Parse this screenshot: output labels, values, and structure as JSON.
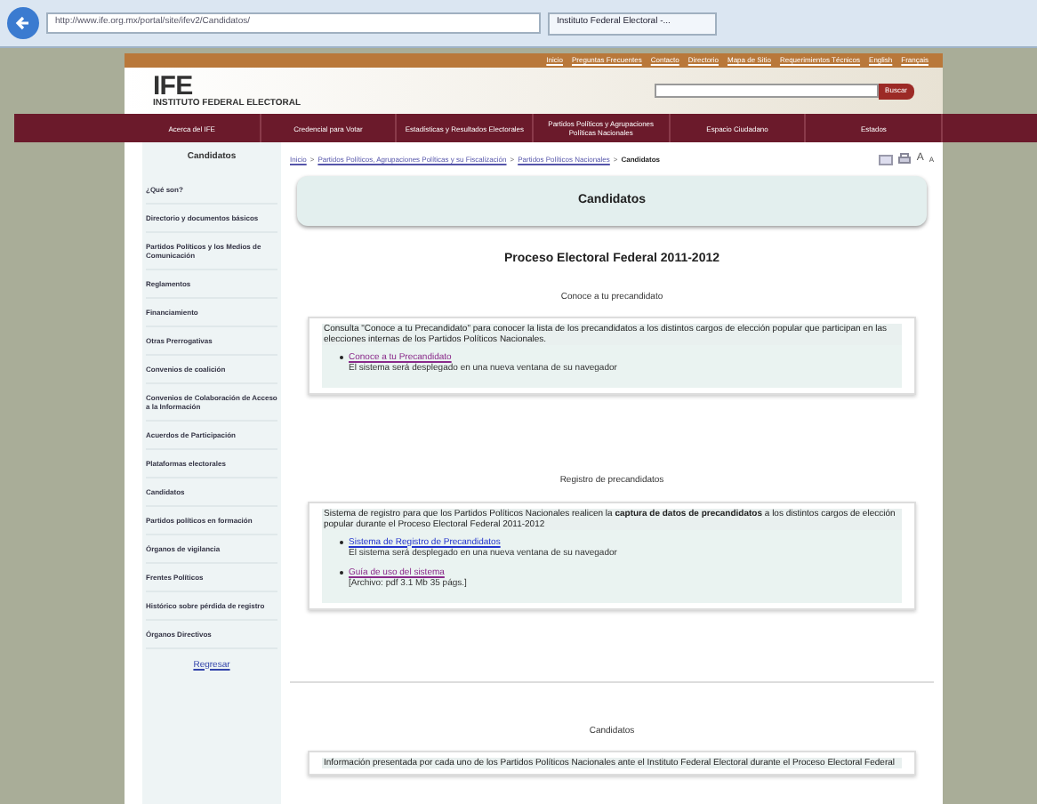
{
  "browser": {
    "address": "http://www.ife.org.mx/portal/site/ifev2/Candidatos/",
    "tab": "Instituto Federal Electoral -..."
  },
  "top_links": [
    "Inicio",
    "Preguntas Frecuentes",
    "Contacto",
    "Directorio",
    "Mapa de Sitio",
    "Requerimientos Técnicos",
    "English",
    "Français"
  ],
  "logo": {
    "name": "IFE",
    "subtitle": "INSTITUTO FEDERAL ELECTORAL"
  },
  "search": {
    "button": "Buscar"
  },
  "nav": [
    "Acerca del IFE",
    "Credencial para Votar",
    "Estadísticas y Resultados Electorales",
    "Partidos Políticos y Agrupaciones Políticas Nacionales",
    "Espacio Ciudadano",
    "Estados"
  ],
  "sidebar": {
    "title": "Candidatos",
    "items": [
      "¿Qué son?",
      "Directorio y documentos básicos",
      "Partidos Políticos y los Medios de Comunicación",
      "Reglamentos",
      "Financiamiento",
      "Otras Prerrogativas",
      "Convenios de coalición",
      "Convenios de Colaboración de Acceso a la Información",
      "Acuerdos de Participación",
      "Plataformas electorales",
      "Candidatos",
      "Partidos políticos en formación",
      "Órganos de vigilancia",
      "Frentes Políticos",
      "Histórico sobre pérdida de registro",
      "Órganos Directivos"
    ],
    "back": "Regresar"
  },
  "breadcrumb": {
    "links": [
      "Inicio",
      "Partidos Políticos, Agrupaciones Políticas y su Fiscalización",
      "Partidos Políticos Nacionales"
    ],
    "separator": ">",
    "current": "Candidatos"
  },
  "page_tools": [
    "A",
    "A"
  ],
  "header": "Candidatos",
  "title": "Proceso Electoral Federal 2011-2012",
  "sections": [
    {
      "title": "Conoce a tu precandidato",
      "intro": "Consulta \"Conoce a tu Precandidato\" para conocer la lista de los precandidatos a los distintos cargos de elección popular que participan en las elecciones internas de los Partidos Políticos Nacionales.",
      "links": [
        {
          "label": "Conoce a tu Precandidato",
          "note": "El sistema será desplegado en una nueva ventana de su navegador",
          "visited": true
        }
      ]
    },
    {
      "title": "Registro de precandidatos",
      "intro": "Sistema de registro para que los Partidos Políticos Nacionales realicen la **captura de datos de precandidatos** a los distintos cargos de elección popular durante el Proceso Electoral Federal 2011-2012",
      "links": [
        {
          "label": "Sistema de Registro de Precandidatos",
          "note": "El sistema será desplegado en una nueva ventana de su navegador",
          "visited": false
        },
        {
          "label": "Guía de uso del sistema",
          "note": "[Archivo: pdf 3.1 Mb 35 págs.]",
          "visited": true
        }
      ]
    },
    {
      "title": "Candidatos",
      "intro": "Información presentada por cada uno de los Partidos Políticos Nacionales ante el Instituto Federal Electoral durante el Proceso Electoral Federal"
    }
  ]
}
